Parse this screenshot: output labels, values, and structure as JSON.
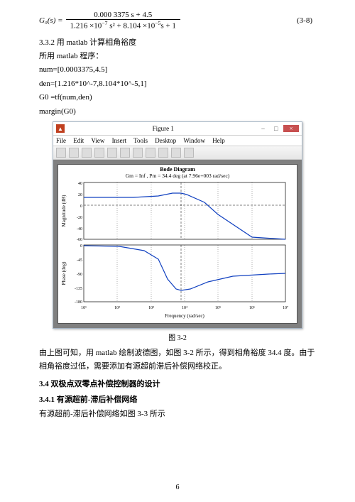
{
  "eq": {
    "lhs": "G₀(s) = ",
    "num": "0.000 3375 s + 4.5",
    "den_a": "1.216 ×10",
    "den_a_sup": "−7",
    "den_b": " s² + 8.104 ×10",
    "den_b_sup": "−5",
    "den_c": "s + 1",
    "num_label": "(3-8)"
  },
  "sec332": "3.3.2 用 matlab 计算相角裕度",
  "progLabel": "所用 matlab 程序：",
  "code1": "num=[0.0003375,4.5]",
  "code2": "den=[1.216*10^-7,8.104*10^-5,1]",
  "code3": "G0 =tf(num,den)",
  "code4": "margin(G0)",
  "fig": {
    "winTitle": "Figure 1",
    "menu": [
      "File",
      "Edit",
      "View",
      "Insert",
      "Tools",
      "Desktop",
      "Window",
      "Help"
    ],
    "plotTitle": "Bode Diagram",
    "plotSub": "Gm = Inf ,  Pm = 34.4 deg (at 7.96e+003 rad/sec)",
    "ylabel1": "Magnitude (dB)",
    "ylabel2": "Phase (deg)",
    "xlabel": "Frequency (rad/sec)",
    "caption": "图 3-2"
  },
  "chart_data": [
    {
      "type": "line",
      "title": "Bode Diagram — Magnitude",
      "xlabel": "Frequency (rad/sec)",
      "ylabel": "Magnitude (dB)",
      "xscale": "log",
      "xlim": [
        10,
        10000000.0
      ],
      "ylim": [
        -60,
        40
      ],
      "yticks": [
        -60,
        -40,
        -20,
        0,
        20,
        40
      ],
      "series": [
        {
          "name": "G0",
          "x": [
            10,
            100,
            1000,
            3000,
            5000,
            7960,
            10000,
            30000,
            100000,
            1000000,
            10000000
          ],
          "values": [
            13,
            13,
            14,
            16,
            19,
            21,
            19,
            5,
            -16,
            -56,
            -60
          ]
        }
      ],
      "annotations": [
        {
          "type": "vline",
          "x": 7960,
          "style": "dashed"
        },
        {
          "type": "hline",
          "y": 0,
          "style": "dashed"
        }
      ]
    },
    {
      "type": "line",
      "title": "Bode Diagram — Phase",
      "xlabel": "Frequency (rad/sec)",
      "ylabel": "Phase (deg)",
      "xscale": "log",
      "xlim": [
        10,
        10000000.0
      ],
      "ylim": [
        -180,
        0
      ],
      "yticks": [
        -180,
        -135,
        -90,
        -45,
        0
      ],
      "series": [
        {
          "name": "G0",
          "x": [
            10,
            100,
            300,
            1000,
            3000,
            7960,
            10000,
            30000,
            100000,
            1000000,
            10000000
          ],
          "values": [
            0,
            -3,
            -8,
            -25,
            -120,
            -145.6,
            -140,
            -115,
            -95,
            -90,
            -90
          ]
        }
      ],
      "annotations": [
        {
          "type": "vline",
          "x": 7960,
          "style": "dashed"
        }
      ]
    }
  ],
  "para1": "由上图可知，用 matlab 绘制波德图，如图 3-2 所示，得到相角裕度 34.4 度。由于相角裕度过低，需要添加有源超前滞后补偿网络校正。",
  "sec34": "3.4 双极点双零点补偿控制器的设计",
  "sec341": "3.4.1 有源超前-滞后补偿网络",
  "para2": "有源超前-滞后补偿网络如图 3-3 所示",
  "pageNumber": "6"
}
